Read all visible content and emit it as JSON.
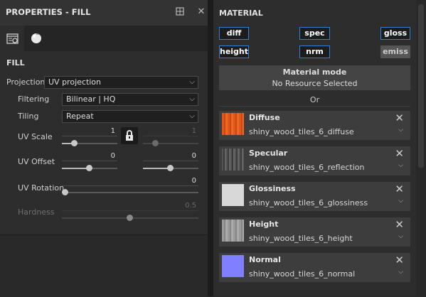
{
  "properties": {
    "title": "PROPERTIES - FILL",
    "tabs": [
      {
        "icon": "fill-properties-icon",
        "active": true
      },
      {
        "icon": "material-sphere-icon",
        "active": false
      }
    ],
    "section": "FILL",
    "projection": {
      "label": "Projection",
      "value": "UV projection"
    },
    "filtering": {
      "label": "Filtering",
      "value": "Bilinear | HQ"
    },
    "tiling": {
      "label": "Tiling",
      "value": "Repeat"
    },
    "uv_scale": {
      "label": "UV Scale",
      "value_u": "1",
      "value_v": "1",
      "fraction_u": 0.2,
      "fraction_v": 0.2
    },
    "uv_offset": {
      "label": "UV Offset",
      "value_u": "0",
      "value_v": "0",
      "fraction_u": 0.5,
      "fraction_v": 0.5
    },
    "uv_rotation": {
      "label": "UV Rotation",
      "value": "0",
      "fraction": 0.0
    },
    "hardness": {
      "label": "Hardness",
      "value": "0.5",
      "fraction": 0.5
    }
  },
  "material": {
    "title": "MATERIAL",
    "channels": [
      {
        "label": "diff",
        "active": true
      },
      {
        "label": "spec",
        "active": true
      },
      {
        "label": "gloss",
        "active": true
      },
      {
        "label": "height",
        "active": true
      },
      {
        "label": "nrm",
        "active": true
      },
      {
        "label": "emiss",
        "active": false
      }
    ],
    "mode_title": "Material mode",
    "mode_value": "No Resource Selected",
    "or_text": "Or",
    "slots": [
      {
        "name": "Diffuse",
        "resource": "shiny_wood_tiles_6_diffuse",
        "thumb_color": "#e0581a"
      },
      {
        "name": "Specular",
        "resource": "shiny_wood_tiles_6_reflection",
        "thumb_color": "#555555"
      },
      {
        "name": "Glossiness",
        "resource": "shiny_wood_tiles_6_glossiness",
        "thumb_color": "#d8d8d8"
      },
      {
        "name": "Height",
        "resource": "shiny_wood_tiles_6_height",
        "thumb_color": "#9a9a9a"
      },
      {
        "name": "Normal",
        "resource": "shiny_wood_tiles_6_normal",
        "thumb_color": "#7f7fff"
      }
    ]
  },
  "colors": {
    "accent": "#2f7fd4",
    "panel": "#2d2d2d",
    "card": "#3d3d3d"
  }
}
